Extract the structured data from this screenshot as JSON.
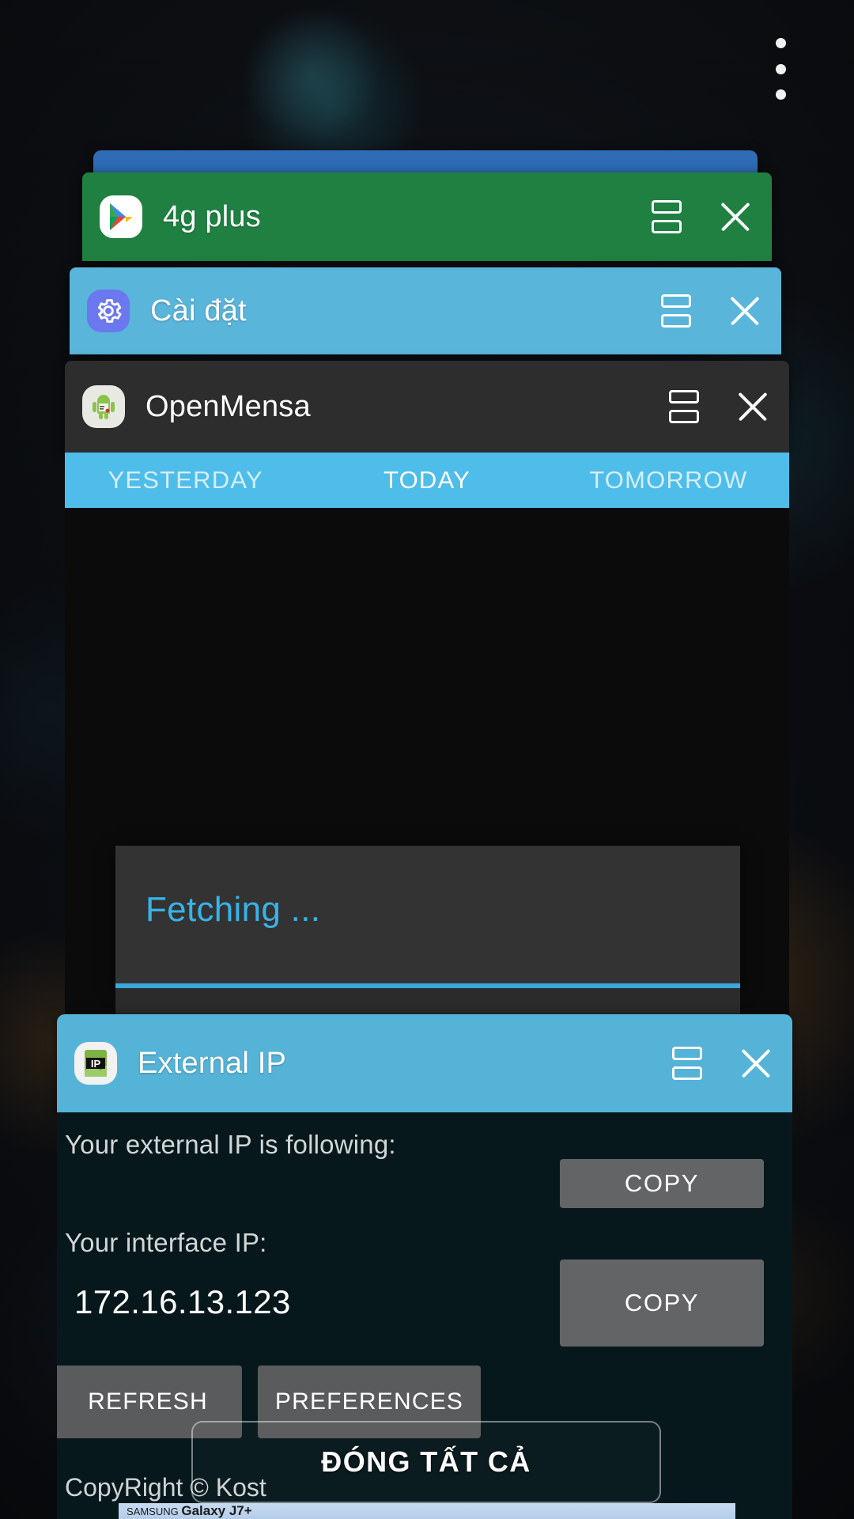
{
  "screen": {
    "title": "Android Recents",
    "overflow_menu_icon": "more-vertical-icon",
    "close_all_label": "ĐÓNG TẤT CẢ"
  },
  "colors": {
    "accent_blue": "#4fbde9",
    "card_green": "#1f8041",
    "card_blue": "#59b5d9",
    "card_dark": "#2d2d2d",
    "card_top_blue": "#2f6cb5",
    "external_ip_header": "#55b3d8",
    "external_ip_body": "#07181d",
    "fetch_text": "#37b4e8",
    "button_grey": "#636466"
  },
  "cards": [
    {
      "id": "peek",
      "title": "",
      "icon": "",
      "header_color": "#2f6cb5"
    },
    {
      "id": "4gplus",
      "title": "4g plus",
      "icon": "play-store-icon",
      "header_color": "#1f8041",
      "split_label": "split-screen-icon",
      "close_label": "close-icon"
    },
    {
      "id": "caidat",
      "title": "Cài đặt",
      "icon": "settings-gear-icon",
      "header_color": "#59b5d9",
      "split_label": "split-screen-icon",
      "close_label": "close-icon"
    },
    {
      "id": "openmensa",
      "title": "OpenMensa",
      "icon": "android-robot-icon",
      "header_color": "#2d2d2d",
      "split_label": "split-screen-icon",
      "close_label": "close-icon"
    },
    {
      "id": "externalip",
      "title": "External IP",
      "icon": "ip-app-icon",
      "header_color": "#55b3d8",
      "split_label": "split-screen-icon",
      "close_label": "close-icon"
    }
  ],
  "openmensa": {
    "tabs": [
      {
        "label": "YESTERDAY",
        "active": false
      },
      {
        "label": "TODAY",
        "active": true
      },
      {
        "label": "TOMORROW",
        "active": false
      }
    ]
  },
  "fetch_dialog": {
    "title": "Fetching ..."
  },
  "external_ip": {
    "external_label": "Your external IP is following:",
    "external_copy_label": "COPY",
    "interface_label": "Your interface IP:",
    "interface_value": "172.16.13.123",
    "interface_copy_label": "COPY",
    "refresh_label": "REFRESH",
    "preferences_label": "PREFERENCES",
    "copyright": "CopyRight © Kost"
  },
  "bottom_banner": {
    "brand_small": "SAMSUNG",
    "brand_large": "Galaxy J7+"
  }
}
